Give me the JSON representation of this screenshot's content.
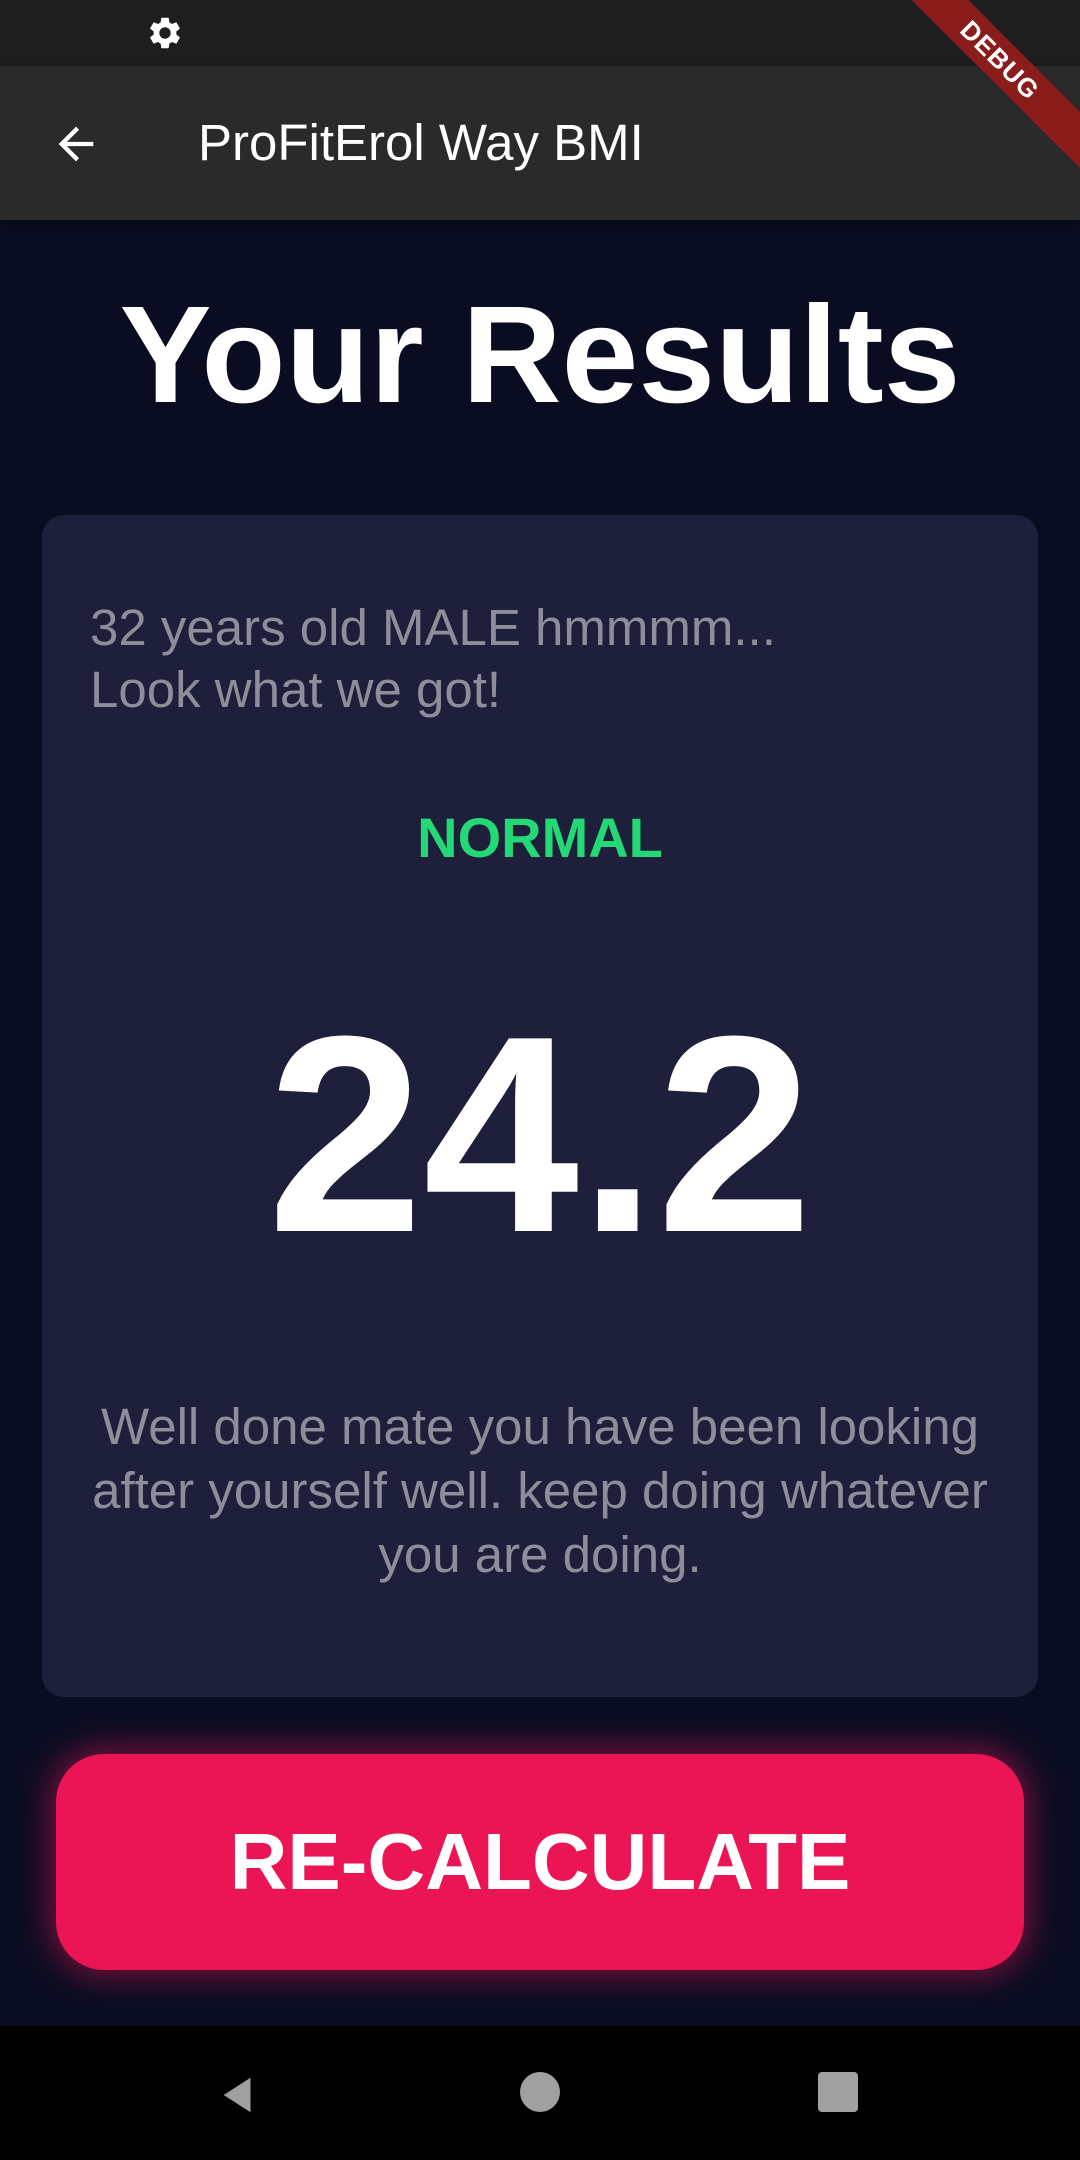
{
  "app_bar": {
    "title": "ProFitErol Way BMI",
    "debug_banner": "DEBUG"
  },
  "page": {
    "title": "Your Results"
  },
  "result_card": {
    "intro_line1": "32 years old MALE hmmmm...",
    "intro_line2": "Look what we got!",
    "status": "NORMAL",
    "bmi": "24.2",
    "advice": "Well done mate you have been looking after yourself well. keep doing whatever you are doing."
  },
  "recalculate_button": {
    "label": "RE-CALCULATE"
  },
  "icons": {
    "status_bar": "gear-icon",
    "back": "arrow-back-icon",
    "nav": [
      "nav-back-icon",
      "nav-home-icon",
      "nav-recents-icon"
    ]
  },
  "colors": {
    "background": "#0a0d22",
    "card": "#1d1f3b",
    "status_normal": "#24d876",
    "accent": "#eb1555"
  }
}
